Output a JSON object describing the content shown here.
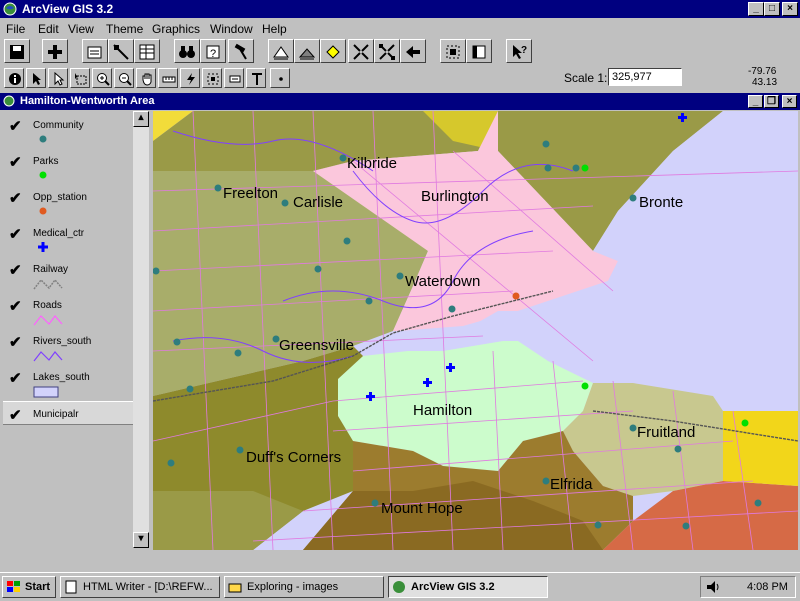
{
  "app": {
    "title": "ArcView GIS 3.2"
  },
  "menu": [
    "File",
    "Edit",
    "View",
    "Theme",
    "Graphics",
    "Window",
    "Help"
  ],
  "scale": {
    "label": "Scale 1:",
    "value": "325,977"
  },
  "coords": {
    "x": "-79.76",
    "y": "43.13"
  },
  "view": {
    "title": "Hamilton-Wentworth Area"
  },
  "layers": [
    {
      "name": "Community",
      "symbol": "dot",
      "color": "#2e7d7d"
    },
    {
      "name": "Parks",
      "symbol": "dot",
      "color": "#00e000"
    },
    {
      "name": "Opp_station",
      "symbol": "dot",
      "color": "#e05a20"
    },
    {
      "name": "Medical_ctr",
      "symbol": "cross",
      "color": "#0000ff"
    },
    {
      "name": "Railway",
      "symbol": "line",
      "color": "#808080"
    },
    {
      "name": "Roads",
      "symbol": "line",
      "color": "#ff60ff"
    },
    {
      "name": "Rivers_south",
      "symbol": "line",
      "color": "#8040ff"
    },
    {
      "name": "Lakes_south",
      "symbol": "rect",
      "color": "#d2d2fb"
    },
    {
      "name": "Municipalr",
      "symbol": "none",
      "color": ""
    }
  ],
  "places": [
    "Kilbride",
    "Burlington",
    "Freelton",
    "Carlisle",
    "Bronte",
    "Waterdown",
    "Greensville",
    "Hamilton",
    "Fruitland",
    "Duff's Corners",
    "Elfrida",
    "Mount Hope"
  ],
  "taskbar": {
    "start": "Start",
    "tasks": [
      "HTML Writer - [D:\\REFW...",
      "Exploring - images",
      "ArcView GIS 3.2"
    ],
    "clock": "4:08 PM"
  }
}
